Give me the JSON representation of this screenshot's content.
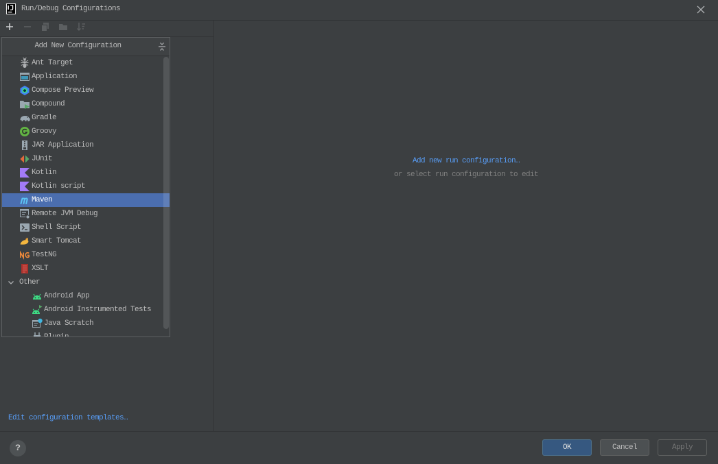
{
  "window": {
    "title": "Run/Debug Configurations",
    "app_icon": "intellij-idea-icon",
    "close_icon": "close-icon"
  },
  "toolbar": {
    "items": [
      {
        "icon": "plus-icon",
        "enabled": true
      },
      {
        "icon": "minus-icon",
        "enabled": false
      },
      {
        "icon": "copy-icon",
        "enabled": false
      },
      {
        "icon": "folder-icon",
        "enabled": false
      },
      {
        "icon": "sort-icon",
        "enabled": false
      }
    ]
  },
  "popup": {
    "title": "Add New Configuration",
    "collapse_icon": "collapse-all-icon",
    "items": [
      {
        "label": "Ant Target",
        "icon": "ant-icon"
      },
      {
        "label": "Application",
        "icon": "application-icon"
      },
      {
        "label": "Compose Preview",
        "icon": "compose-preview-icon"
      },
      {
        "label": "Compound",
        "icon": "compound-icon"
      },
      {
        "label": "Gradle",
        "icon": "gradle-icon"
      },
      {
        "label": "Groovy",
        "icon": "groovy-icon"
      },
      {
        "label": "JAR Application",
        "icon": "jar-icon"
      },
      {
        "label": "JUnit",
        "icon": "junit-icon"
      },
      {
        "label": "Kotlin",
        "icon": "kotlin-icon"
      },
      {
        "label": "Kotlin script",
        "icon": "kotlin-script-icon"
      },
      {
        "label": "Maven",
        "icon": "maven-icon",
        "selected": true
      },
      {
        "label": "Remote JVM Debug",
        "icon": "remote-debug-icon"
      },
      {
        "label": "Shell Script",
        "icon": "shell-script-icon"
      },
      {
        "label": "Smart Tomcat",
        "icon": "tomcat-icon"
      },
      {
        "label": "TestNG",
        "icon": "testng-icon"
      },
      {
        "label": "XSLT",
        "icon": "xslt-icon"
      }
    ],
    "group": {
      "label": "Other",
      "icon": "chevron-down-icon",
      "expanded": true,
      "children": [
        {
          "label": "Android App",
          "icon": "android-icon"
        },
        {
          "label": "Android Instrumented Tests",
          "icon": "android-tests-icon"
        },
        {
          "label": "Java Scratch",
          "icon": "java-scratch-icon"
        },
        {
          "label": "Plugin",
          "icon": "plugin-icon"
        }
      ]
    }
  },
  "left_panel": {
    "templates_link": "Edit configuration templates…"
  },
  "right_panel": {
    "add_link": "Add new run configuration…",
    "hint": "or select run configuration to edit"
  },
  "footer": {
    "help_label": "?",
    "help_icon": "help-icon",
    "ok_label": "OK",
    "cancel_label": "Cancel",
    "apply_label": "Apply",
    "apply_enabled": false
  },
  "colors": {
    "background": "#3c3f41",
    "text": "#bbbbbb",
    "link": "#589df6",
    "selection": "#4b6eaf",
    "default_button": "#365880",
    "hint": "#808080"
  }
}
